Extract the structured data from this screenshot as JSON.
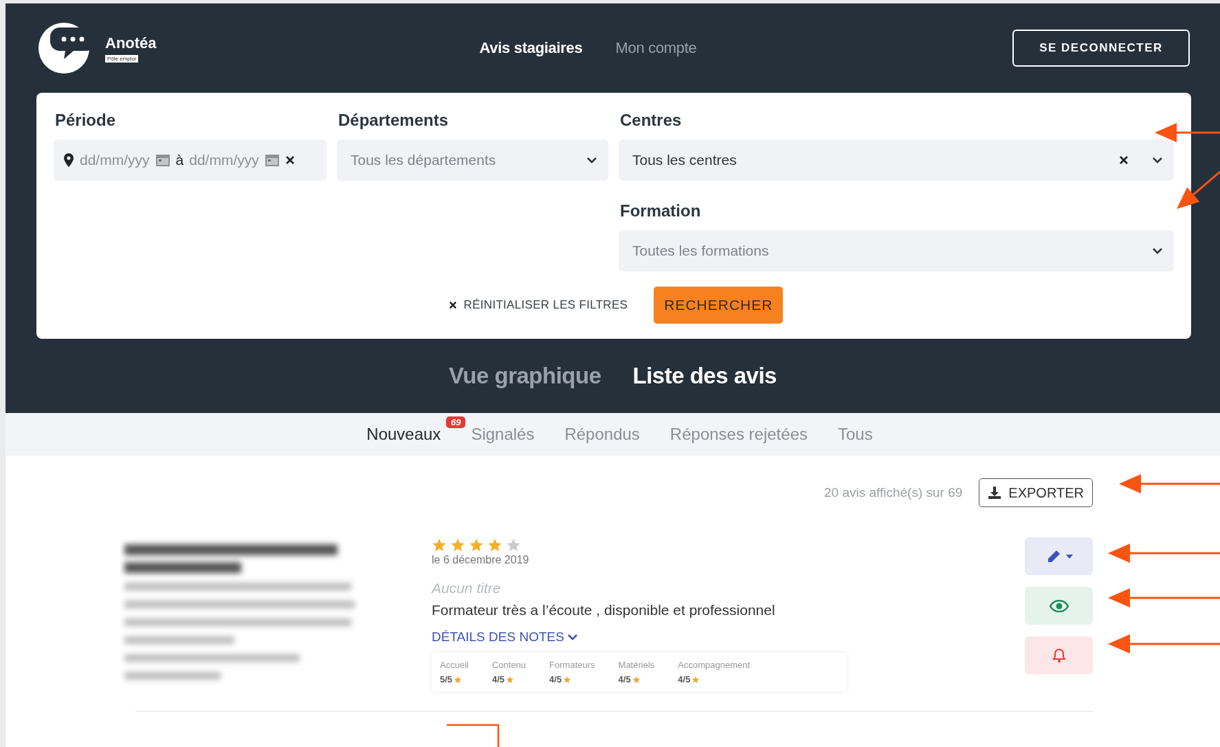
{
  "header": {
    "brand": "Anotéa",
    "brand_badge": "Pôle emploi",
    "nav": [
      {
        "label": "Avis stagiaires",
        "selected": true
      },
      {
        "label": "Mon compte",
        "selected": false
      }
    ],
    "logout": "SE DECONNECTER"
  },
  "filters": {
    "periode": {
      "label": "Période",
      "from": "dd/mm/yyy",
      "separator": "à",
      "to": "dd/mm/yyy"
    },
    "departements": {
      "label": "Départements",
      "placeholder": "Tous les départements"
    },
    "centres": {
      "label": "Centres",
      "value": "Tous les centres"
    },
    "formation": {
      "label": "Formation",
      "placeholder": "Toutes les formations"
    },
    "reset": "RÉINITIALISER LES FILTRES",
    "search": "RECHERCHER"
  },
  "views": [
    {
      "label": "Vue graphique",
      "selected": false
    },
    {
      "label": "Liste des avis",
      "selected": true
    }
  ],
  "tabs": [
    {
      "label": "Nouveaux",
      "selected": true,
      "badge": "69"
    },
    {
      "label": "Signalés",
      "selected": false
    },
    {
      "label": "Répondus",
      "selected": false
    },
    {
      "label": "Réponses rejetées",
      "selected": false
    },
    {
      "label": "Tous",
      "selected": false
    }
  ],
  "results": {
    "count": "20 avis affiché(s) sur 69",
    "export": "EXPORTER"
  },
  "review": {
    "stars": 4,
    "date": "le 6 décembre 2019",
    "title": "Aucun titre",
    "comment": "Formateur très a l’écoute , disponible et professionnel",
    "details_link": "DÉTAILS DES NOTES",
    "notes": [
      {
        "label": "Accueil",
        "value": "5/5"
      },
      {
        "label": "Contenu",
        "value": "4/5"
      },
      {
        "label": "Formateurs",
        "value": "4/5"
      },
      {
        "label": "Matériels",
        "value": "4/5"
      },
      {
        "label": "Accompagnement",
        "value": "4/5"
      }
    ]
  }
}
